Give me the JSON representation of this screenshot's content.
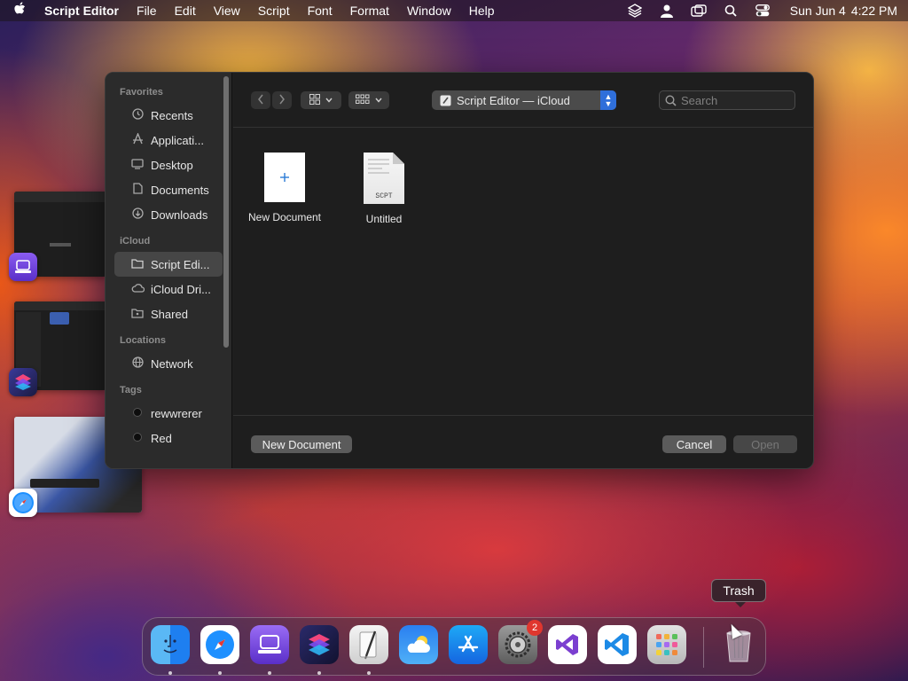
{
  "menubar": {
    "app_name": "Script Editor",
    "menus": [
      "File",
      "Edit",
      "View",
      "Script",
      "Font",
      "Format",
      "Window",
      "Help"
    ],
    "date": "Sun Jun 4",
    "time": "4:22 PM"
  },
  "sidebar": {
    "favorites_heading": "Favorites",
    "favorites": [
      {
        "label": "Recents",
        "icon": "clock-icon"
      },
      {
        "label": "Applicati...",
        "icon": "applications-icon"
      },
      {
        "label": "Desktop",
        "icon": "desktop-icon"
      },
      {
        "label": "Documents",
        "icon": "document-icon"
      },
      {
        "label": "Downloads",
        "icon": "download-icon"
      }
    ],
    "icloud_heading": "iCloud",
    "icloud": [
      {
        "label": "Script Edi...",
        "icon": "folder-icon",
        "selected": true
      },
      {
        "label": "iCloud Dri...",
        "icon": "cloud-icon"
      },
      {
        "label": "Shared",
        "icon": "shared-folder-icon"
      }
    ],
    "locations_heading": "Locations",
    "locations": [
      {
        "label": "Network",
        "icon": "globe-icon"
      }
    ],
    "tags_heading": "Tags",
    "tags": [
      {
        "label": "rewwrerer",
        "color": "#111111"
      },
      {
        "label": "Red",
        "color": "#111111"
      }
    ]
  },
  "toolbar": {
    "location": "Script Editor — iCloud",
    "search_placeholder": "Search"
  },
  "files": [
    {
      "label": "New Document",
      "kind": "new-document"
    },
    {
      "label": "Untitled",
      "kind": "scpt",
      "badge": "SCPT"
    }
  ],
  "footer": {
    "new_document": "New Document",
    "cancel": "Cancel",
    "open": "Open"
  },
  "dock": {
    "tooltip": "Trash",
    "settings_badge": "2",
    "apps": [
      "Finder",
      "Safari",
      "Apple Configurator",
      "Shortcuts",
      "Script Editor",
      "Weather",
      "App Store",
      "System Settings",
      "Visual Studio",
      "Visual Studio Code",
      "Launchpad",
      "Trash"
    ]
  },
  "colors": {
    "accent": "#2f6fda",
    "dialog_bg": "#1e1e1e",
    "sidebar_bg": "#2b2b2b"
  }
}
